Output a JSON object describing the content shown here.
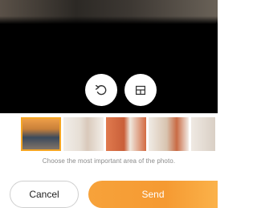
{
  "editor": {
    "buttons": {
      "rotate_icon": "rotate-icon",
      "crop_icon": "crop-icon"
    }
  },
  "thumbnails": [
    {
      "name": "landscape-photo",
      "selected": true
    },
    {
      "name": "family-photo-2",
      "selected": false
    },
    {
      "name": "family-photo-3",
      "selected": false
    },
    {
      "name": "family-photo-4",
      "selected": false
    },
    {
      "name": "family-photo-5",
      "selected": false
    }
  ],
  "caption": "Choose the most important area of the photo.",
  "actions": {
    "cancel_label": "Cancel",
    "send_label": "Send"
  },
  "colors": {
    "accent": "#f5a623",
    "send_gradient_start": "#f7a23a",
    "caption_text": "#8a8a8a"
  }
}
